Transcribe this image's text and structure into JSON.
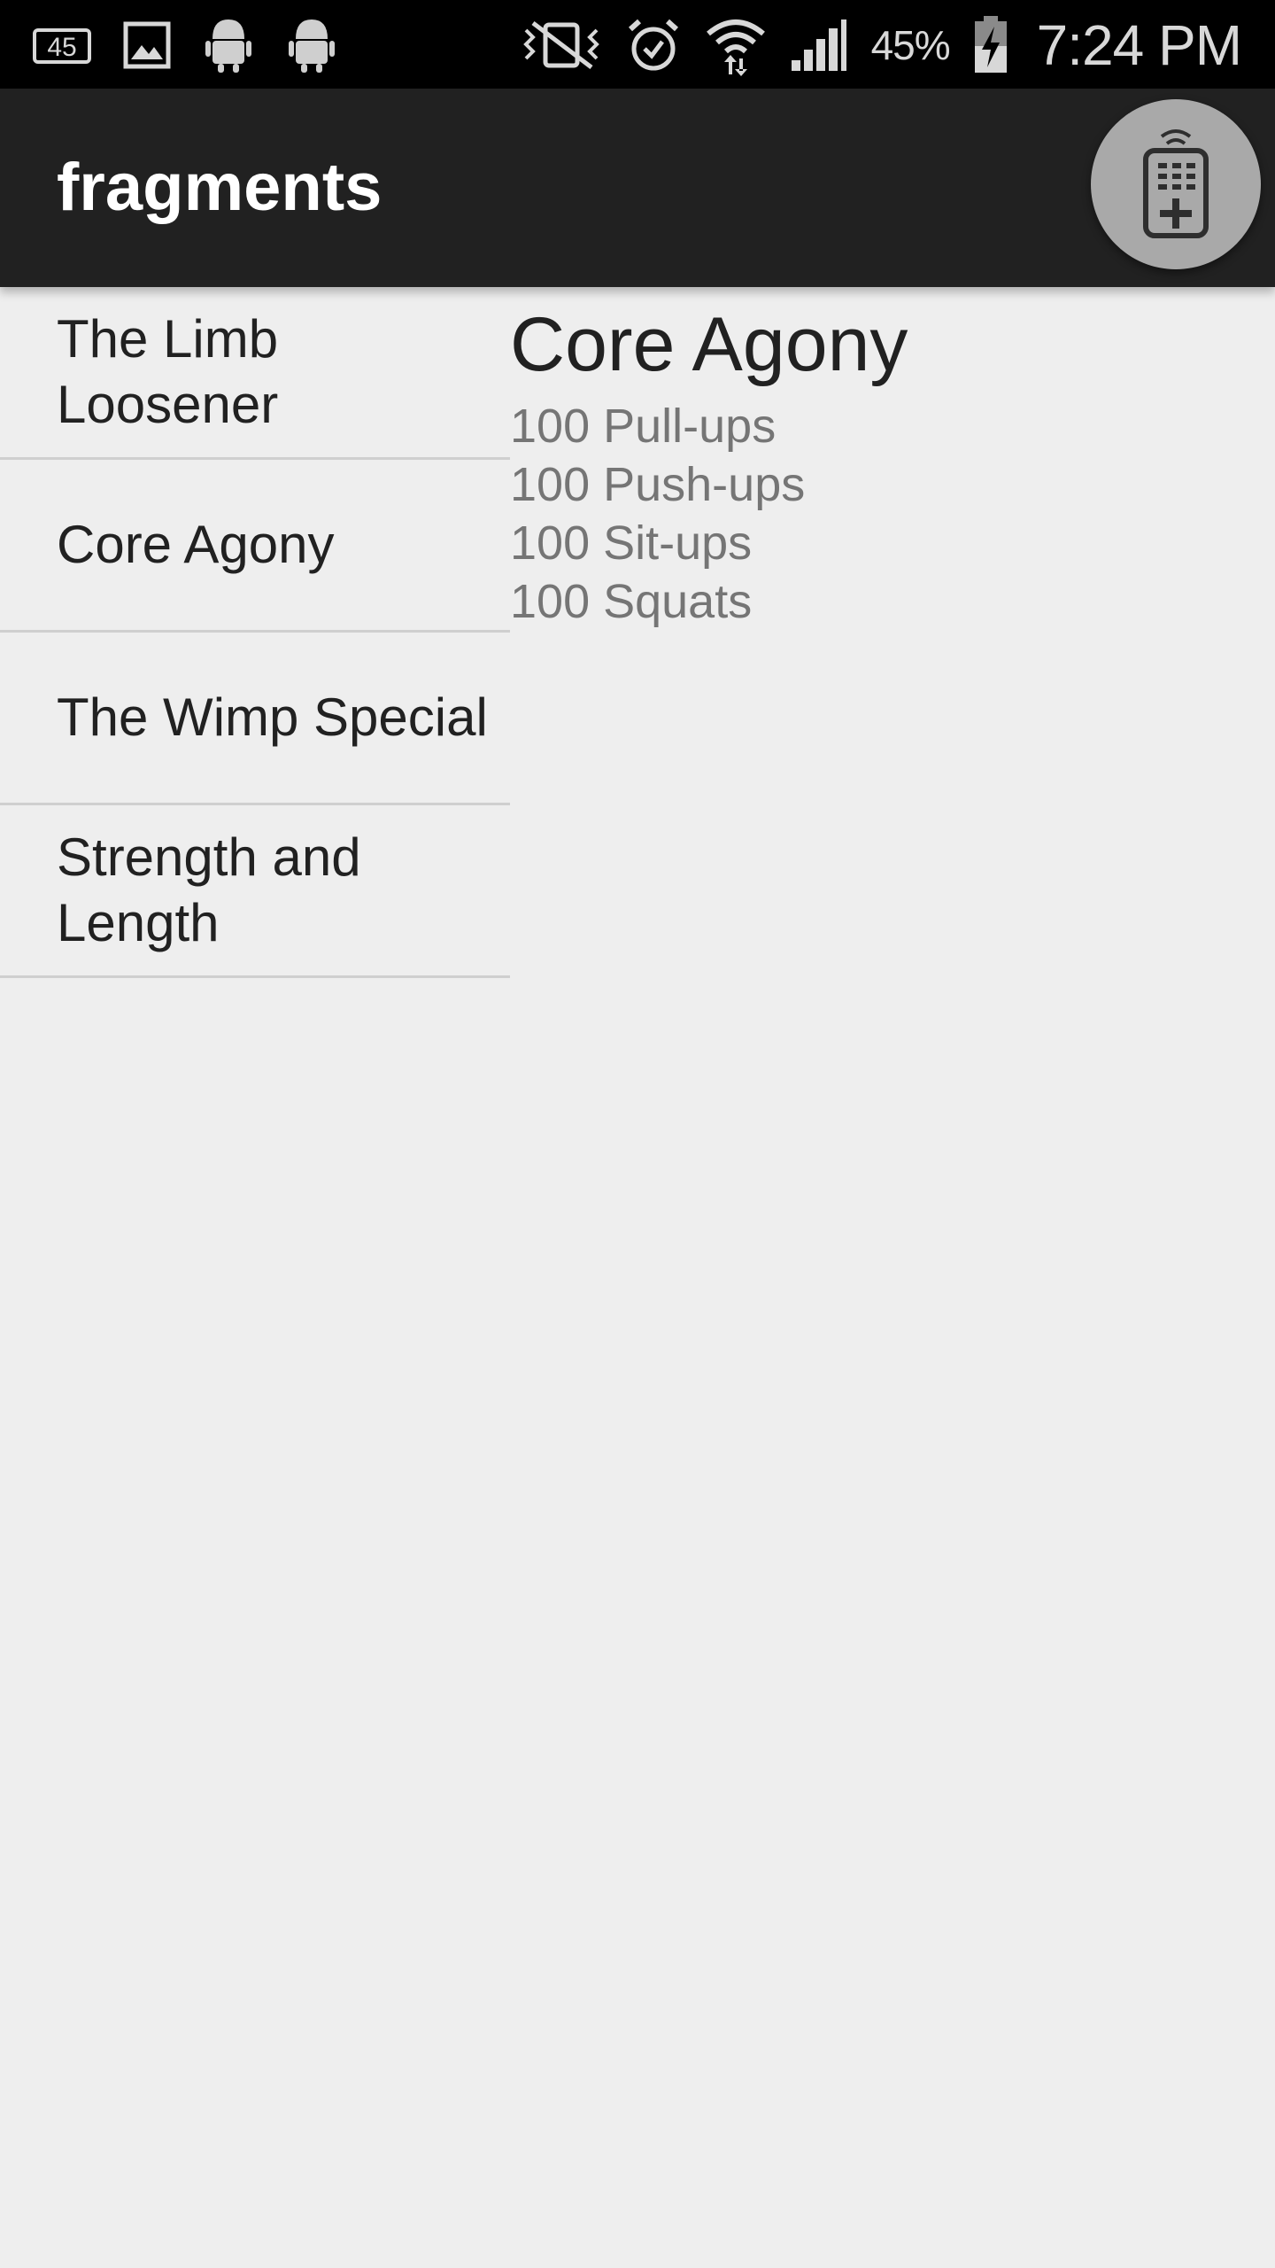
{
  "status_bar": {
    "notification_badge": "45",
    "battery_percent": "45%",
    "time": "7:24 PM",
    "icons": [
      "notification-45-icon",
      "gallery-icon",
      "android-icon",
      "android-icon",
      "vibrate-icon",
      "alarm-icon",
      "wifi-icon",
      "signal-icon",
      "battery-charging-icon"
    ]
  },
  "app_bar": {
    "title": "fragments",
    "remote_icon": "remote-control-icon"
  },
  "workouts": [
    {
      "label": "The Limb Loosener"
    },
    {
      "label": "Core Agony"
    },
    {
      "label": "The Wimp Special"
    },
    {
      "label": "Strength and Length"
    }
  ],
  "detail": {
    "title": "Core Agony",
    "lines": [
      "100 Pull-ups",
      "100 Push-ups",
      "100 Sit-ups",
      "100 Squats"
    ]
  },
  "colors": {
    "status_bar": "#000000",
    "app_bar": "#212121",
    "background": "#eeeeee",
    "divider": "#cfcfcf",
    "secondary_text": "#757575",
    "fab": "#a9a9a9"
  }
}
